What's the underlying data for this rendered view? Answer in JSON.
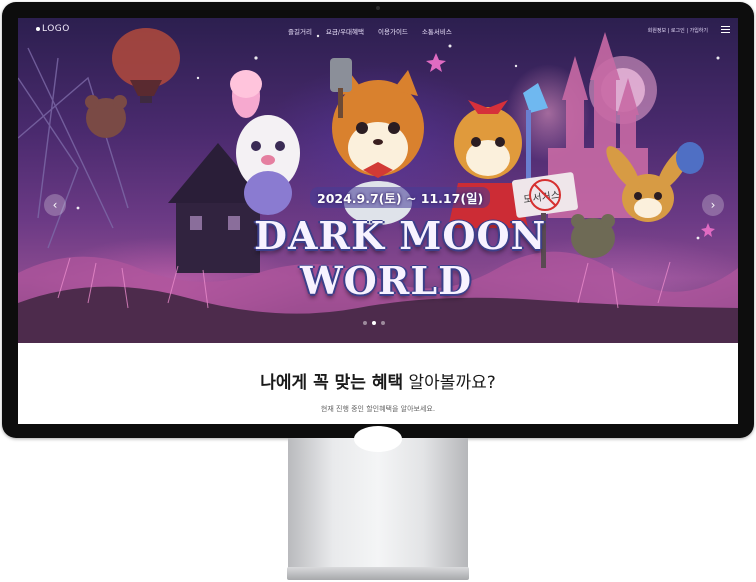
{
  "nav": {
    "logo": "LOGO",
    "menu": [
      "즐길거리",
      "요금/우대혜택",
      "이용가이드",
      "소통서비스"
    ],
    "utility": "회원정보 | 로그인 | 가입하기",
    "menu_icon": "hamburger-icon"
  },
  "hero": {
    "date": "2024.9.7(토) ~ 11.17(일)",
    "title_line1": "DARK MOON",
    "title_line2": "WORLD",
    "sign_text": "도서거스",
    "prev_icon": "chevron-left-icon",
    "next_icon": "chevron-right-icon",
    "slide_count": 3,
    "active_slide": 2
  },
  "benefit": {
    "headline_bold": "나에게 꼭 맞는 혜택",
    "headline_light": "알아볼까요?",
    "subline": "현재 진행 중인 할인혜택을 알아보세요."
  },
  "colors": {
    "hero_top": "#2c1f4f",
    "hero_mid": "#6b3a85",
    "hero_pink": "#e26fbe",
    "title_outline": "#3b3f8a",
    "bezel": "#0d0d0d",
    "stand": "#e9eaec"
  }
}
